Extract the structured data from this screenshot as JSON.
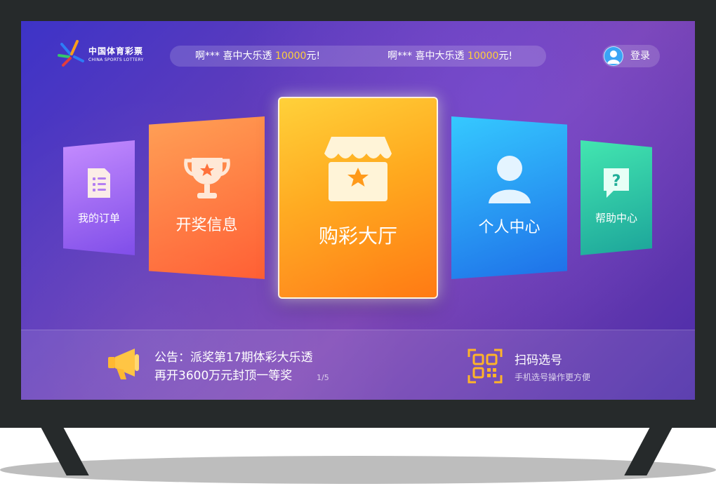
{
  "logo": {
    "cn": "中国体育彩票",
    "en": "CHINA SPORTS LOTTERY"
  },
  "ticker": {
    "items": [
      {
        "prefix": "啊*** 喜中大乐透 ",
        "amount": "10000",
        "suffix": "元!"
      },
      {
        "prefix": "啊*** 喜中大乐透 ",
        "amount": "10000",
        "suffix": "元!"
      }
    ]
  },
  "header": {
    "login_label": "登录"
  },
  "cards": {
    "orders": {
      "label": "我的订单",
      "icon": "document-icon"
    },
    "draw_info": {
      "label": "开奖信息",
      "icon": "trophy-icon"
    },
    "hall": {
      "label": "购彩大厅",
      "icon": "store-icon"
    },
    "personal": {
      "label": "个人中心",
      "icon": "user-icon"
    },
    "help": {
      "label": "帮助中心",
      "icon": "question-bubble-icon"
    }
  },
  "notice": {
    "line1": "公告：派奖第17期体彩大乐透",
    "line2": "再开3600万元封顶一等奖",
    "page": "1/5",
    "icon": "megaphone-icon"
  },
  "scan": {
    "title": "扫码选号",
    "subtitle": "手机选号操作更方便",
    "icon": "qr-code-icon"
  },
  "colors": {
    "accent_amount": "#ffcf3a",
    "hall_card": "#ff9a1a",
    "draw_card": "#ff6a3a",
    "personal_card": "#2aa0f5",
    "orders_card": "#a06af0",
    "help_card": "#2cc7a4"
  }
}
